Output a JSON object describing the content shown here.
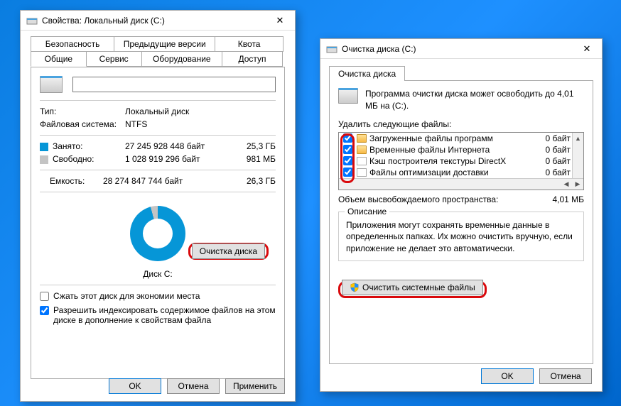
{
  "win1": {
    "title": "Свойства: Локальный диск (C:)",
    "tabs_row1": [
      "Безопасность",
      "Предыдущие версии",
      "Квота"
    ],
    "tabs_row2": [
      "Общие",
      "Сервис",
      "Оборудование",
      "Доступ"
    ],
    "type_label": "Тип:",
    "type_value": "Локальный диск",
    "fs_label": "Файловая система:",
    "fs_value": "NTFS",
    "used_label": "Занято:",
    "used_bytes": "27 245 928 448 байт",
    "used_gb": "25,3 ГБ",
    "free_label": "Свободно:",
    "free_bytes": "1 028 919 296 байт",
    "free_gb": "981 МБ",
    "cap_label": "Емкость:",
    "cap_bytes": "28 274 847 744 байт",
    "cap_gb": "26,3 ГБ",
    "disk_label": "Диск C:",
    "cleanup_btn": "Очистка диска",
    "compress_chk": "Сжать этот диск для экономии места",
    "index_chk": "Разрешить индексировать содержимое файлов на этом диске в дополнение к свойствам файла",
    "ok": "OK",
    "cancel": "Отмена",
    "apply": "Применить"
  },
  "win2": {
    "title": "Очистка диска  (C:)",
    "tab": "Очистка диска",
    "info": "Программа очистки диска может освободить до 4,01 МБ на  (C:).",
    "list_label": "Удалить следующие файлы:",
    "files": [
      {
        "name": "Загруженные файлы программ",
        "size": "0 байт",
        "checked": true,
        "icon": "folder"
      },
      {
        "name": "Временные файлы Интернета",
        "size": "0 байт",
        "checked": true,
        "icon": "folder"
      },
      {
        "name": "Кэш построителя текстуры DirectX",
        "size": "0 байт",
        "checked": true,
        "icon": "file"
      },
      {
        "name": "Файлы оптимизации доставки",
        "size": "0 байт",
        "checked": true,
        "icon": "file"
      }
    ],
    "freed_label": "Объем высвобождаемого пространства:",
    "freed_value": "4,01 МБ",
    "desc_title": "Описание",
    "desc_text": "Приложения могут сохранять временные данные в определенных папках. Их можно очистить вручную, если приложение не делает это автоматически.",
    "sys_btn": "Очистить системные файлы",
    "ok": "OK",
    "cancel": "Отмена"
  },
  "chart_data": {
    "type": "pie",
    "title": "Диск C:",
    "series": [
      {
        "name": "Занято",
        "value": 27245928448,
        "display": "25,3 ГБ",
        "color": "#0696d7"
      },
      {
        "name": "Свободно",
        "value": 1028919296,
        "display": "981 МБ",
        "color": "#c4c4c4"
      }
    ],
    "total": {
      "value": 28274847744,
      "display": "26,3 ГБ"
    }
  }
}
